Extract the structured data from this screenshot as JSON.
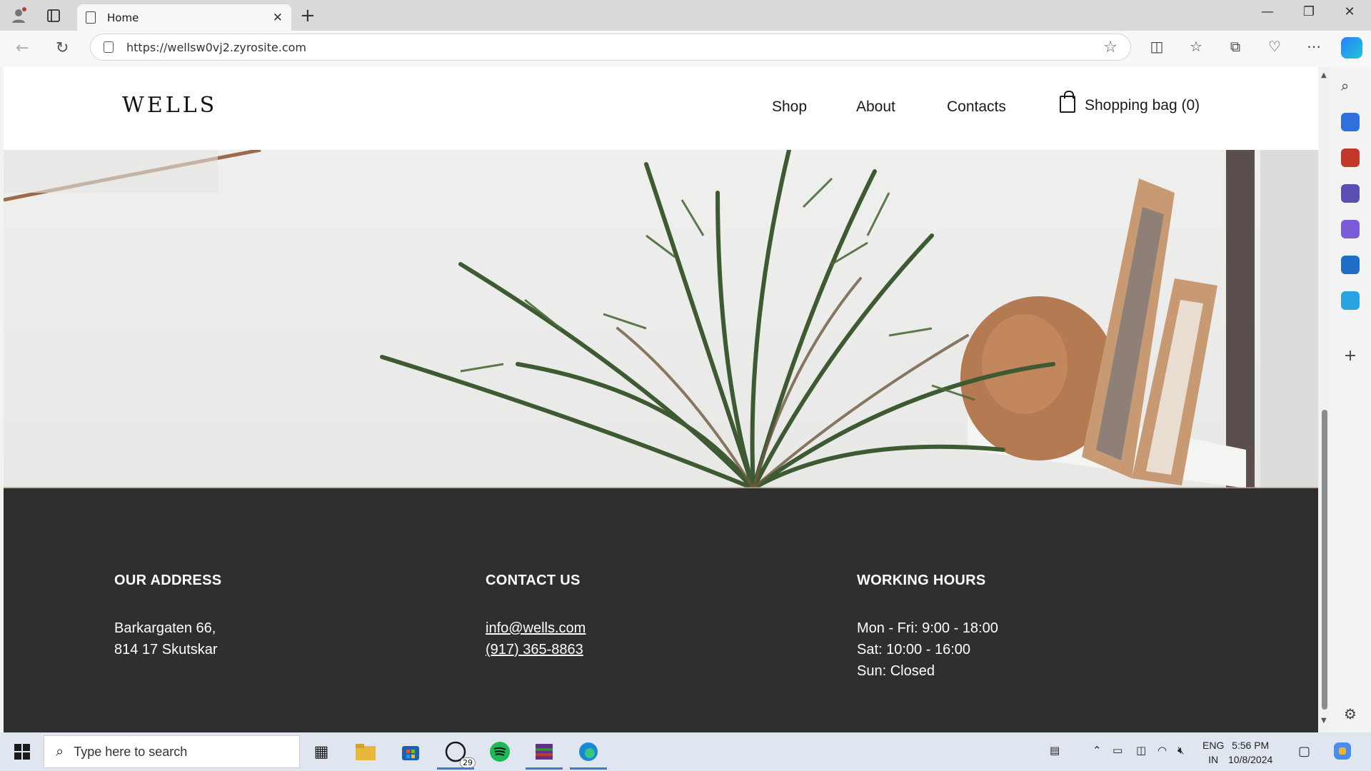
{
  "browser": {
    "tab_title": "Home",
    "url": "https://wellsw0vj2.zyrosite.com"
  },
  "site": {
    "logo": "WELLS",
    "nav": {
      "shop": "Shop",
      "about": "About",
      "contacts": "Contacts",
      "bag": "Shopping bag (0)"
    },
    "footer": {
      "address": {
        "heading": "OUR ADDRESS",
        "line1": "Barkargaten 66,",
        "line2": "814 17 Skutskar"
      },
      "contact": {
        "heading": "CONTACT US",
        "email": "info@wells.com",
        "phone": "(917) 365-8863"
      },
      "hours": {
        "heading": "WORKING HOURS",
        "weekday": "Mon - Fri: 9:00 - 18:00",
        "saturday": "Sat: 10:00 - 16:00",
        "sunday": "Sun: Closed"
      }
    }
  },
  "taskbar": {
    "search_placeholder": "Type here to search",
    "whatsapp_badge": "29",
    "lang": "ENG",
    "region": "IN",
    "time": "5:56 PM",
    "date": "10/8/2024"
  },
  "colors": {
    "footer_bg": "#2f2f2f",
    "accent_blue": "#3a7bd5"
  }
}
